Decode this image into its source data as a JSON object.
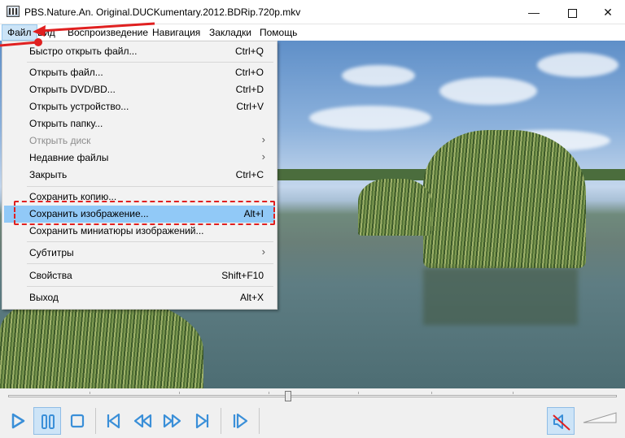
{
  "window": {
    "title": "PBS.Nature.An. Original.DUCKumentary.2012.BDRip.720p.mkv",
    "minimize_glyph": "—",
    "close_glyph": "✕"
  },
  "menubar": {
    "items": [
      "Файл",
      "Вид",
      "Воспроизведение",
      "Навигация",
      "Закладки",
      "Помощь"
    ]
  },
  "file_menu": {
    "items": [
      {
        "label": "Быстро открыть файл...",
        "shortcut": "Ctrl+Q"
      },
      {
        "label": "Открыть файл...",
        "shortcut": "Ctrl+O"
      },
      {
        "label": "Открыть DVD/BD...",
        "shortcut": "Ctrl+D"
      },
      {
        "label": "Открыть устройство...",
        "shortcut": "Ctrl+V"
      },
      {
        "label": "Открыть папку...",
        "shortcut": ""
      },
      {
        "label": "Открыть диск",
        "shortcut": "",
        "submenu": true,
        "disabled": true
      },
      {
        "label": "Недавние файлы",
        "shortcut": "",
        "submenu": true
      },
      {
        "label": "Закрыть",
        "shortcut": "Ctrl+C"
      },
      {
        "label": "Сохранить копию...",
        "shortcut": ""
      },
      {
        "label": "Сохранить изображение...",
        "shortcut": "Alt+I",
        "highlighted": true
      },
      {
        "label": "Сохранить миниатюры изображений...",
        "shortcut": ""
      },
      {
        "label": "Субтитры",
        "shortcut": "",
        "submenu": true
      },
      {
        "label": "Свойства",
        "shortcut": "Shift+F10"
      },
      {
        "label": "Выход",
        "shortcut": "Alt+X"
      }
    ],
    "submenu_glyph": "›"
  },
  "playback": {
    "position": 0.46,
    "state": "paused"
  },
  "controls": [
    "play-icon",
    "pause-icon",
    "stop-icon",
    "skip-back-icon",
    "rewind-icon",
    "fast-forward-icon",
    "skip-forward-icon",
    "frame-step-icon",
    "mute-icon"
  ],
  "colors": {
    "highlight": "#91c9f7",
    "annotation": "#e02020",
    "control_accent": "#3a8fd8"
  }
}
